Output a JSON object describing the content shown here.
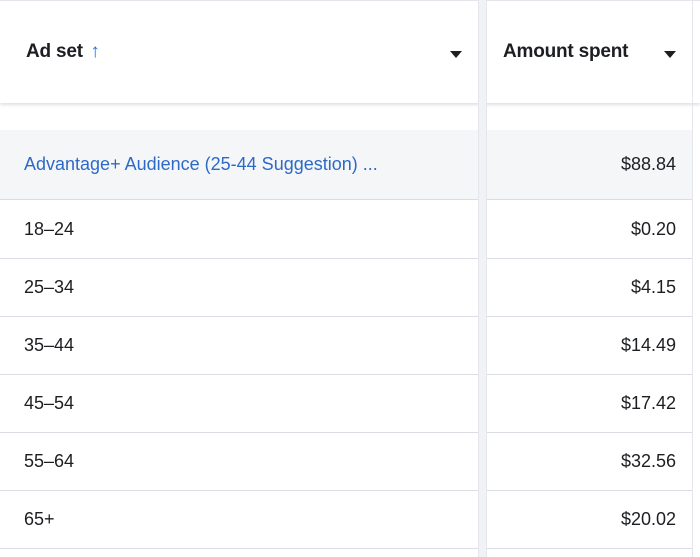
{
  "header": {
    "ad_set_label": "Ad set",
    "ad_set_sort_icon": "↑",
    "amount_spent_label": "Amount spent"
  },
  "group_row": {
    "ad_set": "Advantage+ Audience (25-44 Suggestion) ...",
    "amount_spent": "$88.84"
  },
  "rows": [
    {
      "ad_set": "18–24",
      "amount_spent": "$0.20"
    },
    {
      "ad_set": "25–34",
      "amount_spent": "$4.15"
    },
    {
      "ad_set": "35–44",
      "amount_spent": "$14.49"
    },
    {
      "ad_set": "45–54",
      "amount_spent": "$17.42"
    },
    {
      "ad_set": "55–64",
      "amount_spent": "$32.56"
    },
    {
      "ad_set": "65+",
      "amount_spent": "$20.02"
    }
  ],
  "colors": {
    "link_blue": "#2d6ac8",
    "sort_blue": "#1b74e4",
    "divider_gray": "#f0f2f5"
  },
  "icons": {
    "sort": "arrow-up-icon",
    "menu": "caret-down-icon"
  }
}
